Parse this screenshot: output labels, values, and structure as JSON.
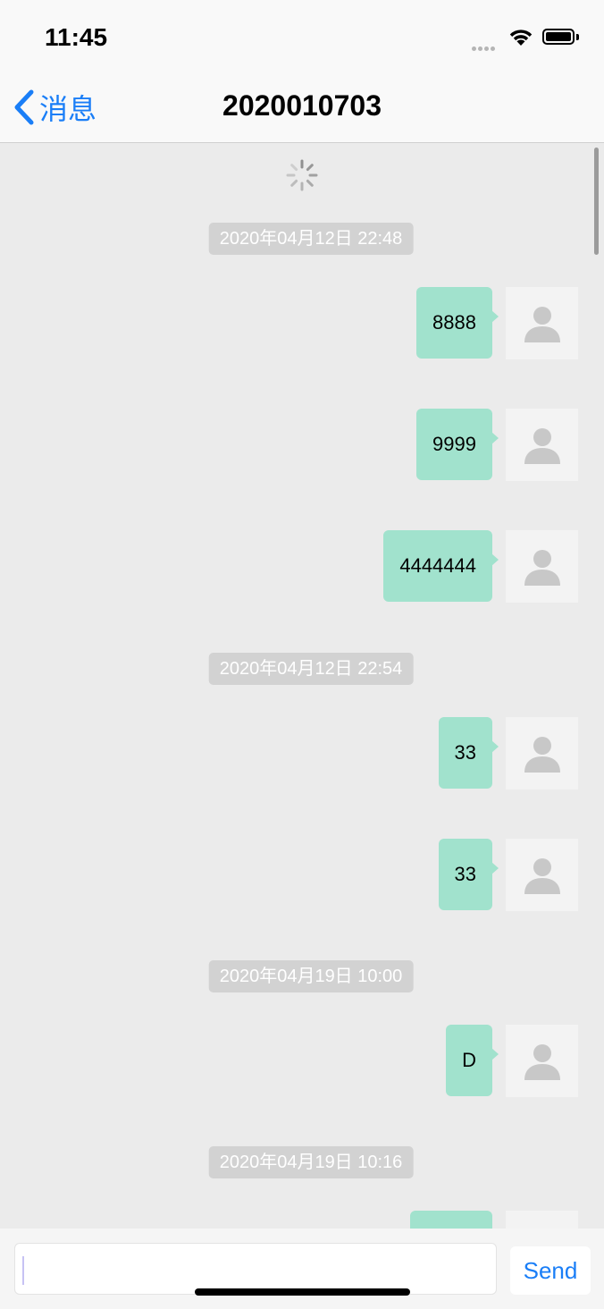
{
  "status_bar": {
    "time": "11:45"
  },
  "nav": {
    "back_label": "消息",
    "title": "2020010703"
  },
  "messages": [
    {
      "type": "timestamp",
      "text": "2020年04月12日 22:48"
    },
    {
      "type": "sent",
      "text": "8888"
    },
    {
      "type": "sent",
      "text": "9999"
    },
    {
      "type": "sent",
      "text": "4444444"
    },
    {
      "type": "timestamp",
      "text": "2020年04月12日 22:54"
    },
    {
      "type": "sent",
      "text": "33"
    },
    {
      "type": "sent",
      "text": "33"
    },
    {
      "type": "timestamp",
      "text": "2020年04月19日 10:00"
    },
    {
      "type": "sent",
      "text": "D"
    },
    {
      "type": "timestamp",
      "text": "2020年04月19日 10:16"
    },
    {
      "type": "sent",
      "text": ""
    }
  ],
  "input": {
    "value": "",
    "send_label": "Send"
  },
  "colors": {
    "accent": "#1a7ef7",
    "bubble": "#a1e2cd",
    "background": "#ebebeb",
    "timestamp_bg": "#d2d2d2"
  }
}
